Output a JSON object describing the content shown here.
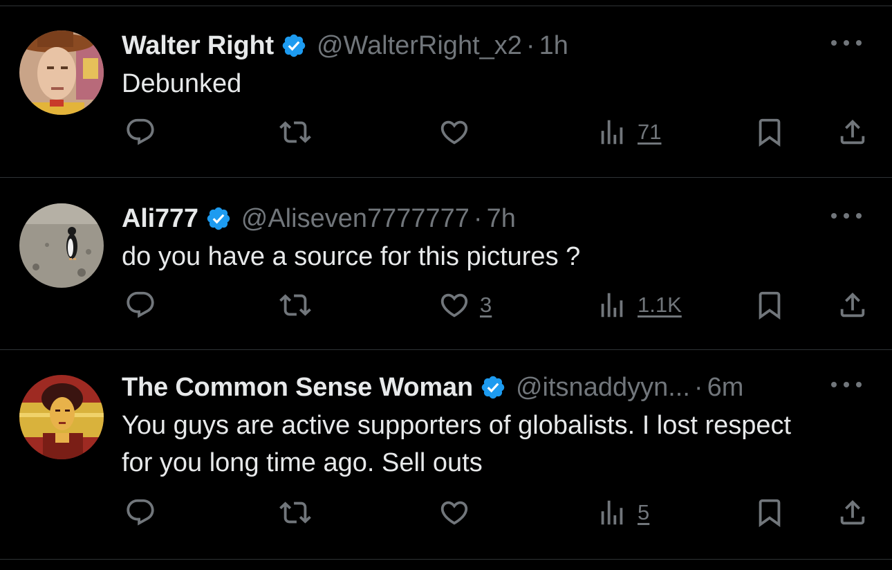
{
  "posts": [
    {
      "name": "Walter Right",
      "handle": "@WalterRight_x2",
      "separator": "·",
      "time": "1h",
      "text": "Debunked",
      "avatar_icon": "woody-avatar",
      "likes": "",
      "views": "71"
    },
    {
      "name": "Ali777",
      "handle": "@Aliseven7777777",
      "separator": "·",
      "time": "7h",
      "text": "do you have a source for this pictures ?",
      "avatar_icon": "penguin-avatar",
      "likes": "3",
      "views": "1.1K"
    },
    {
      "name": "The Common Sense Woman",
      "handle": "@itsnaddyyn...",
      "separator": "·",
      "time": "6m",
      "text": "You guys are active supporters of globalists. I lost respect for you long time ago. Sell outs",
      "avatar_icon": "woman-portrait-avatar",
      "likes": "",
      "views": "5"
    }
  ],
  "colors": {
    "background": "#000000",
    "text_primary": "#e7e9ea",
    "text_secondary": "#71767b",
    "verified_blue": "#1d9bf0",
    "divider": "#2f3336"
  }
}
